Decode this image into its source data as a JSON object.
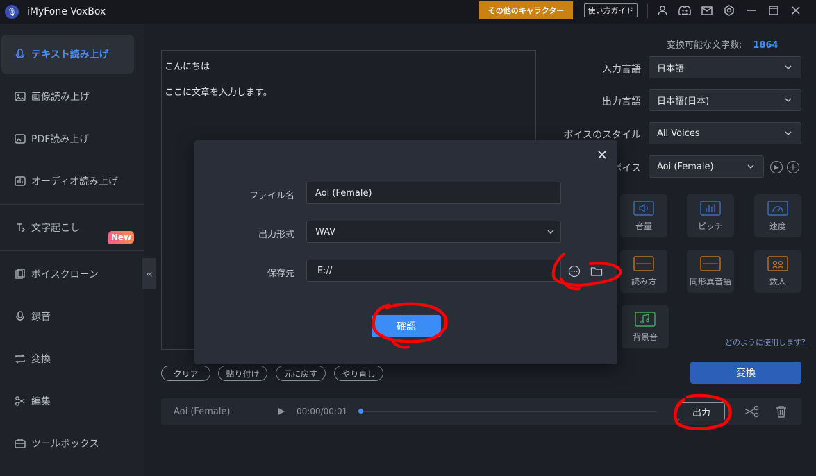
{
  "app": {
    "title": "iMyFone VoxBox"
  },
  "titlebar": {
    "character_button": "その他のキャラクター",
    "guide_button": "使い方ガイド",
    "icons": [
      "user-icon",
      "discord-icon",
      "mail-icon",
      "settings-icon",
      "minimize-icon",
      "maximize-icon",
      "close-icon"
    ]
  },
  "sidebar": {
    "items": [
      {
        "label": "テキスト読み上げ",
        "icon": "mic-text-icon",
        "active": true
      },
      {
        "label": "画像読み上げ",
        "icon": "image-icon"
      },
      {
        "label": "PDF読み上げ",
        "icon": "pdf-icon"
      },
      {
        "label": "オーディオ読み上げ",
        "icon": "audio-file-icon"
      },
      {
        "label": "文字起こし",
        "icon": "transcribe-icon"
      },
      {
        "label": "ボイスクローン",
        "icon": "voice-clone-icon"
      },
      {
        "label": "録音",
        "icon": "microphone-icon"
      },
      {
        "label": "変換",
        "icon": "convert-icon"
      },
      {
        "label": "編集",
        "icon": "scissors-icon"
      },
      {
        "label": "ツールボックス",
        "icon": "toolbox-icon"
      }
    ],
    "new_badge": "New"
  },
  "counter": {
    "label": "変換可能な文字数:",
    "value": "1864"
  },
  "editor": {
    "lines": [
      "こんにちは",
      "ここに文章を入力します。"
    ]
  },
  "settings": {
    "input_language": {
      "label": "入力言語",
      "value": "日本語"
    },
    "output_language": {
      "label": "出力言語",
      "value": "日本語(日本)"
    },
    "voice_style": {
      "label": "ボイスのスタイル",
      "value": "All Voices"
    },
    "voice": {
      "label": "ボイス",
      "value": "Aoi (Female)"
    }
  },
  "tiles": [
    {
      "label": "音量",
      "icon": "volume-icon"
    },
    {
      "label": "ピッチ",
      "icon": "pitch-icon"
    },
    {
      "label": "速度",
      "icon": "speed-icon"
    },
    {
      "label": "読み方",
      "icon": "reading-icon"
    },
    {
      "label": "同形異音語",
      "icon": "homograph-icon"
    },
    {
      "label": "数人",
      "icon": "number-icon"
    },
    {
      "label": "背景音",
      "icon": "music-icon"
    }
  ],
  "help_link": "どのように使用します？",
  "convert_button": "変換",
  "editor_actions": [
    "クリア",
    "貼り付け",
    "元に戻す",
    "やり直し"
  ],
  "player": {
    "voice_name": "Aoi (Female)",
    "time": "00:00/00:01",
    "progress": 0
  },
  "export_button": "出力",
  "modal": {
    "file_name": {
      "label": "ファイル名",
      "value": "Aoi (Female)"
    },
    "format": {
      "label": "出力形式",
      "value": "WAV"
    },
    "save_to": {
      "label": "保存先",
      "value": "E://"
    },
    "confirm_button": "確認"
  },
  "colors": {
    "accent": "#4b8df8",
    "character_button": "#c98211",
    "annotation": "#ff0000"
  }
}
